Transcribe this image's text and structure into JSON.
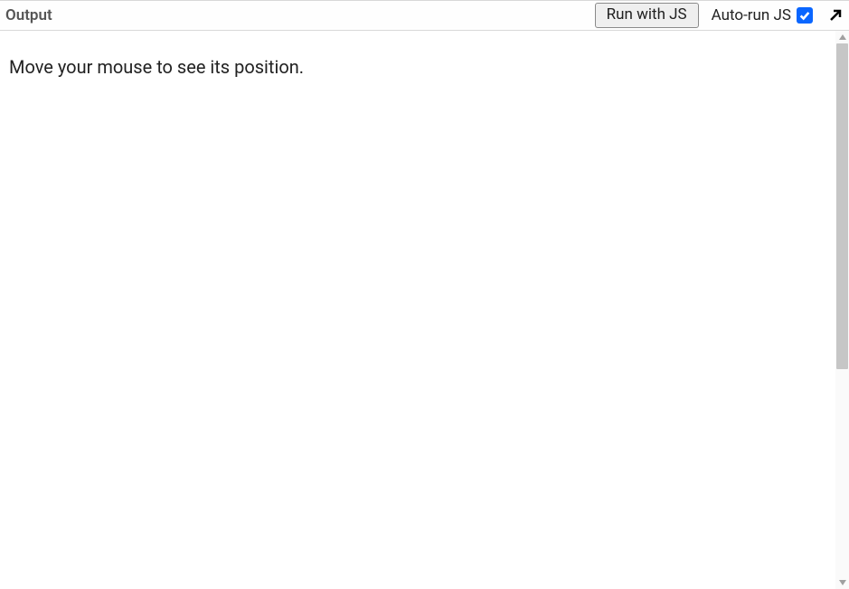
{
  "header": {
    "title": "Output",
    "run_button_label": "Run with JS",
    "autorun_label": "Auto-run JS",
    "autorun_checked": true
  },
  "output": {
    "message": "Move your mouse to see its position."
  }
}
